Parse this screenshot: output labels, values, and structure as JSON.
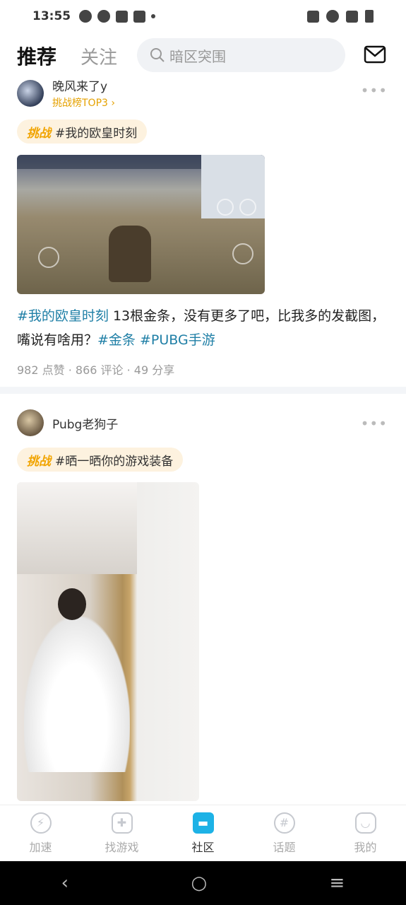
{
  "status_bar": {
    "time": "13:55"
  },
  "header": {
    "tab_active": "推荐",
    "tab_follow": "关注",
    "search_placeholder": "暗区突围"
  },
  "posts": [
    {
      "author": "晚风来了y",
      "badge": "挑战榜TOP3 ›",
      "challenge_tag": "挑战",
      "challenge_topic": "#我的欧皇时刻",
      "text_hashtag1": "#我的欧皇时刻",
      "text_body": " 13根金条，没有更多了吧，比我多的发截图，嘴说有啥用？",
      "text_hashtag2": "#金条",
      "text_hashtag3": "#PUBG手游",
      "stats": "982 点赞 · 866 评论 · 49 分享"
    },
    {
      "author": "Pubg老狗子",
      "challenge_tag": "挑战",
      "challenge_topic": "#晒一晒你的游戏装备"
    }
  ],
  "bottom_nav": [
    {
      "label": "加速",
      "icon": "lightning-icon"
    },
    {
      "label": "找游戏",
      "icon": "gamepad-icon"
    },
    {
      "label": "社区",
      "icon": "community-icon"
    },
    {
      "label": "话题",
      "icon": "hashtag-icon"
    },
    {
      "label": "我的",
      "icon": "profile-icon"
    }
  ],
  "colors": {
    "accent": "#1db2e6",
    "hashtag": "#1f7fa6",
    "challenge": "#f1a400"
  }
}
